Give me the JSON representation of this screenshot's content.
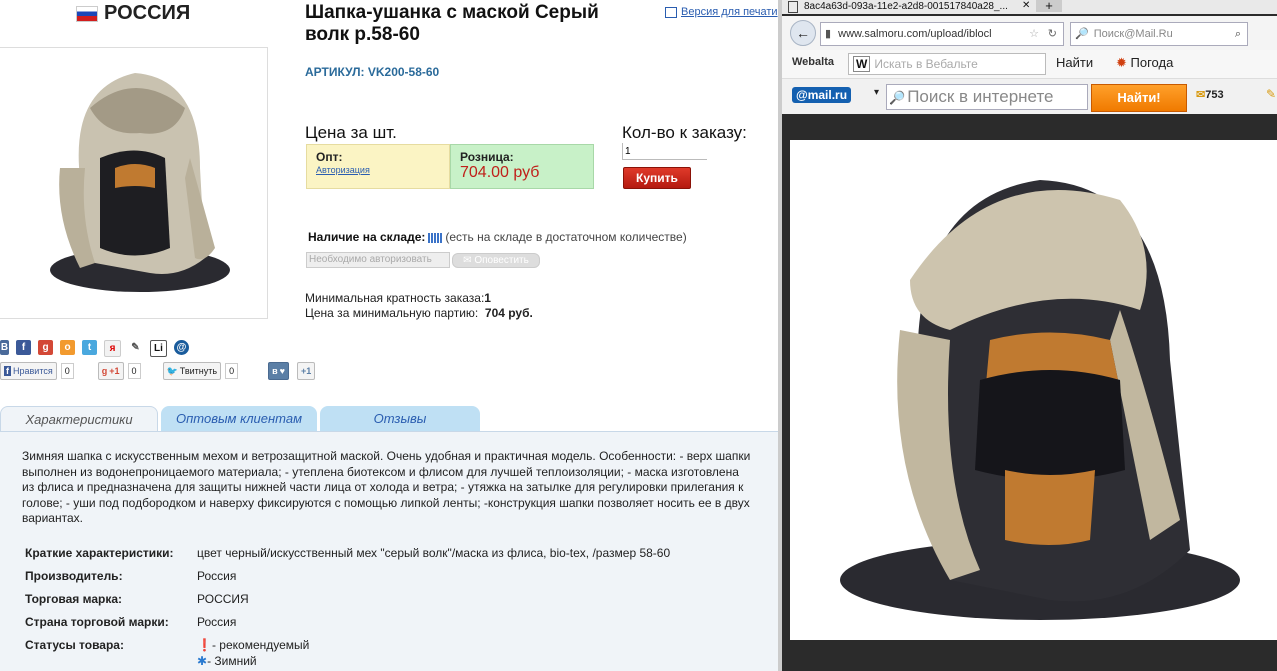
{
  "left": {
    "brand": "РОССИЯ",
    "title": "Шапка-ушанка с маской Серый волк р.58-60",
    "print_link": "Версия для печати",
    "article": "АРТИКУЛ: VK200-58-60",
    "price_heading": "Цена за шт.",
    "qty_heading": "Кол-во к заказу:",
    "opt_label": "Опт:",
    "opt_link": "Авторизация",
    "retail_label": "Розница:",
    "retail_price": "704.00 руб",
    "qty_value": "1",
    "buy_label": "Купить",
    "stock_label": "Наличие на складе:",
    "stock_text": "(есть на складе в достаточном количестве)",
    "auth_required": "Необходимо авторизовать",
    "notify_label": "Оповестить",
    "min_order_label": "Минимальная кратность заказа:",
    "min_order_value": "1",
    "min_price_label": "Цена за минимальную партию:",
    "min_price_value": "704 руб.",
    "like_fb": "Нравится",
    "like_fb_count": "0",
    "like_g": "+1",
    "like_g_count": "0",
    "tweet": "Твитнуть",
    "tweet_count": "0",
    "vk_plus": "+1",
    "tabs": [
      "Характеристики",
      "Оптовым клиентам",
      "Отзывы"
    ],
    "description": "Зимняя шапка с искусственным мехом и ветрозащитной маской. Очень удобная и практичная модель. Особенности: - верх шапки выполнен из водонепроницаемого материала; - утеплена биотексом и флисом для лучшей теплоизоляции; - маска изготовлена из флиса и предназначена для защиты нижней части лица от холода и ветра; - утяжка на затылке для регулировки прилегания к голове; - уши под подбородком и наверху фиксируются с помощью липкой ленты; -конструкция шапки позволяет носить ее в двух вариантах.",
    "chars": [
      {
        "k": "Краткие характеристики:",
        "v": "цвет черный/искусственный мех \"серый волк\"/маска из флиса, bio-tex, /размер 58-60"
      },
      {
        "k": "Производитель:",
        "v": "Россия"
      },
      {
        "k": "Торговая марка:",
        "v": "РОССИЯ"
      },
      {
        "k": "Страна торговой марки:",
        "v": "Россия"
      },
      {
        "k": "Статусы товара:",
        "v": "- рекомендуемый"
      }
    ],
    "status_winter": "- Зимний"
  },
  "right": {
    "tab_title": "8ac4a63d-093a-11e2-a2d8-001517840a28_...",
    "url": "www.salmoru.com/upload/iblocl",
    "search_placeholder": "Поиск@Mail.Ru",
    "webalta": "Webalta",
    "webalta_search": "Искать в Вебальте",
    "find": "Найти",
    "weather": "Погода",
    "mail_logo": "@mail.ru",
    "mail_search": "Поиск в интернете",
    "mail_find": "Найти!",
    "mail_count": "753"
  }
}
